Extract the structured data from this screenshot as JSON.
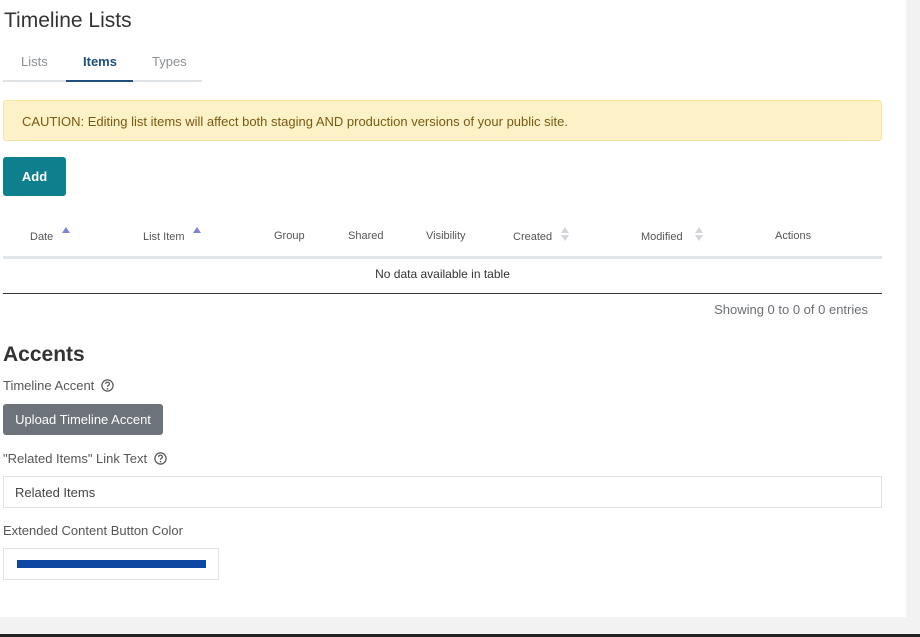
{
  "page": {
    "title": "Timeline Lists"
  },
  "tabs": [
    {
      "label": "Lists",
      "active": false
    },
    {
      "label": "Items",
      "active": true
    },
    {
      "label": "Types",
      "active": false
    }
  ],
  "alert": {
    "text": "CAUTION: Editing list items will affect both staging AND production versions of your public site."
  },
  "toolbar": {
    "add_label": "Add"
  },
  "table": {
    "columns": [
      {
        "label": "Date",
        "sort": "asc"
      },
      {
        "label": "List Item",
        "sort": "asc"
      },
      {
        "label": "Group",
        "sort": "none"
      },
      {
        "label": "Shared",
        "sort": "none"
      },
      {
        "label": "Visibility",
        "sort": "none"
      },
      {
        "label": "Created",
        "sort": "both"
      },
      {
        "label": "Modified",
        "sort": "both"
      },
      {
        "label": "Actions",
        "sort": "none"
      }
    ],
    "empty_text": "No data available in table",
    "info": "Showing 0 to 0 of 0 entries"
  },
  "accents": {
    "title": "Accents",
    "timeline_accent_label": "Timeline Accent",
    "upload_label": "Upload Timeline Accent",
    "link_text_label": "\"Related Items\" Link Text",
    "link_text_value": "Related Items",
    "button_color_label": "Extended Content Button Color",
    "button_color": "#0d47a1"
  },
  "colors": {
    "brand_teal": "#0e7f8c",
    "tab_active": "#1f4f7a",
    "sort_active": "#7b86d6",
    "sort_inactive": "#d3d6da"
  }
}
